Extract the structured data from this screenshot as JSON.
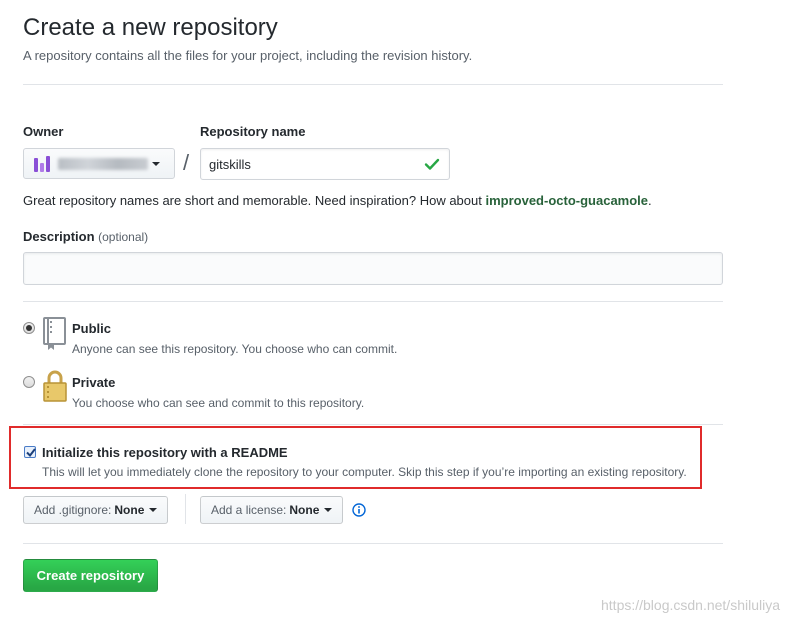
{
  "header": {
    "title": "Create a new repository",
    "subtitle": "A repository contains all the files for your project, including the revision history."
  },
  "owner": {
    "label": "Owner",
    "avatar_icon": "org-avatar-icon"
  },
  "repo_name": {
    "label": "Repository name",
    "value": "gitskills",
    "valid_icon": "check-icon",
    "separator": "/"
  },
  "hint": {
    "text": "Great repository names are short and memorable. Need inspiration? How about",
    "suggestion": "improved-octo-guacamole",
    "end": "."
  },
  "description": {
    "label": "Description",
    "optional": "(optional)",
    "value": ""
  },
  "visibility": {
    "public": {
      "title": "Public",
      "desc": "Anyone can see this repository. You choose who can commit.",
      "selected": true,
      "icon": "repo-book-icon"
    },
    "private": {
      "title": "Private",
      "desc": "You choose who can see and commit to this repository.",
      "selected": false,
      "icon": "lock-icon"
    }
  },
  "readme": {
    "title": "Initialize this repository with a README",
    "desc": "This will let you immediately clone the repository to your computer. Skip this step if you’re importing an existing repository.",
    "checked": true
  },
  "gitignore": {
    "prefix": "Add .gitignore:",
    "value": "None"
  },
  "license": {
    "prefix": "Add a license:",
    "value": "None"
  },
  "submit": {
    "label": "Create repository"
  },
  "watermark": "https://blog.csdn.net/shiluliya",
  "colors": {
    "primary_green": "#28a745",
    "highlight_red": "#e02b2b",
    "suggestion_green": "#28623a"
  }
}
